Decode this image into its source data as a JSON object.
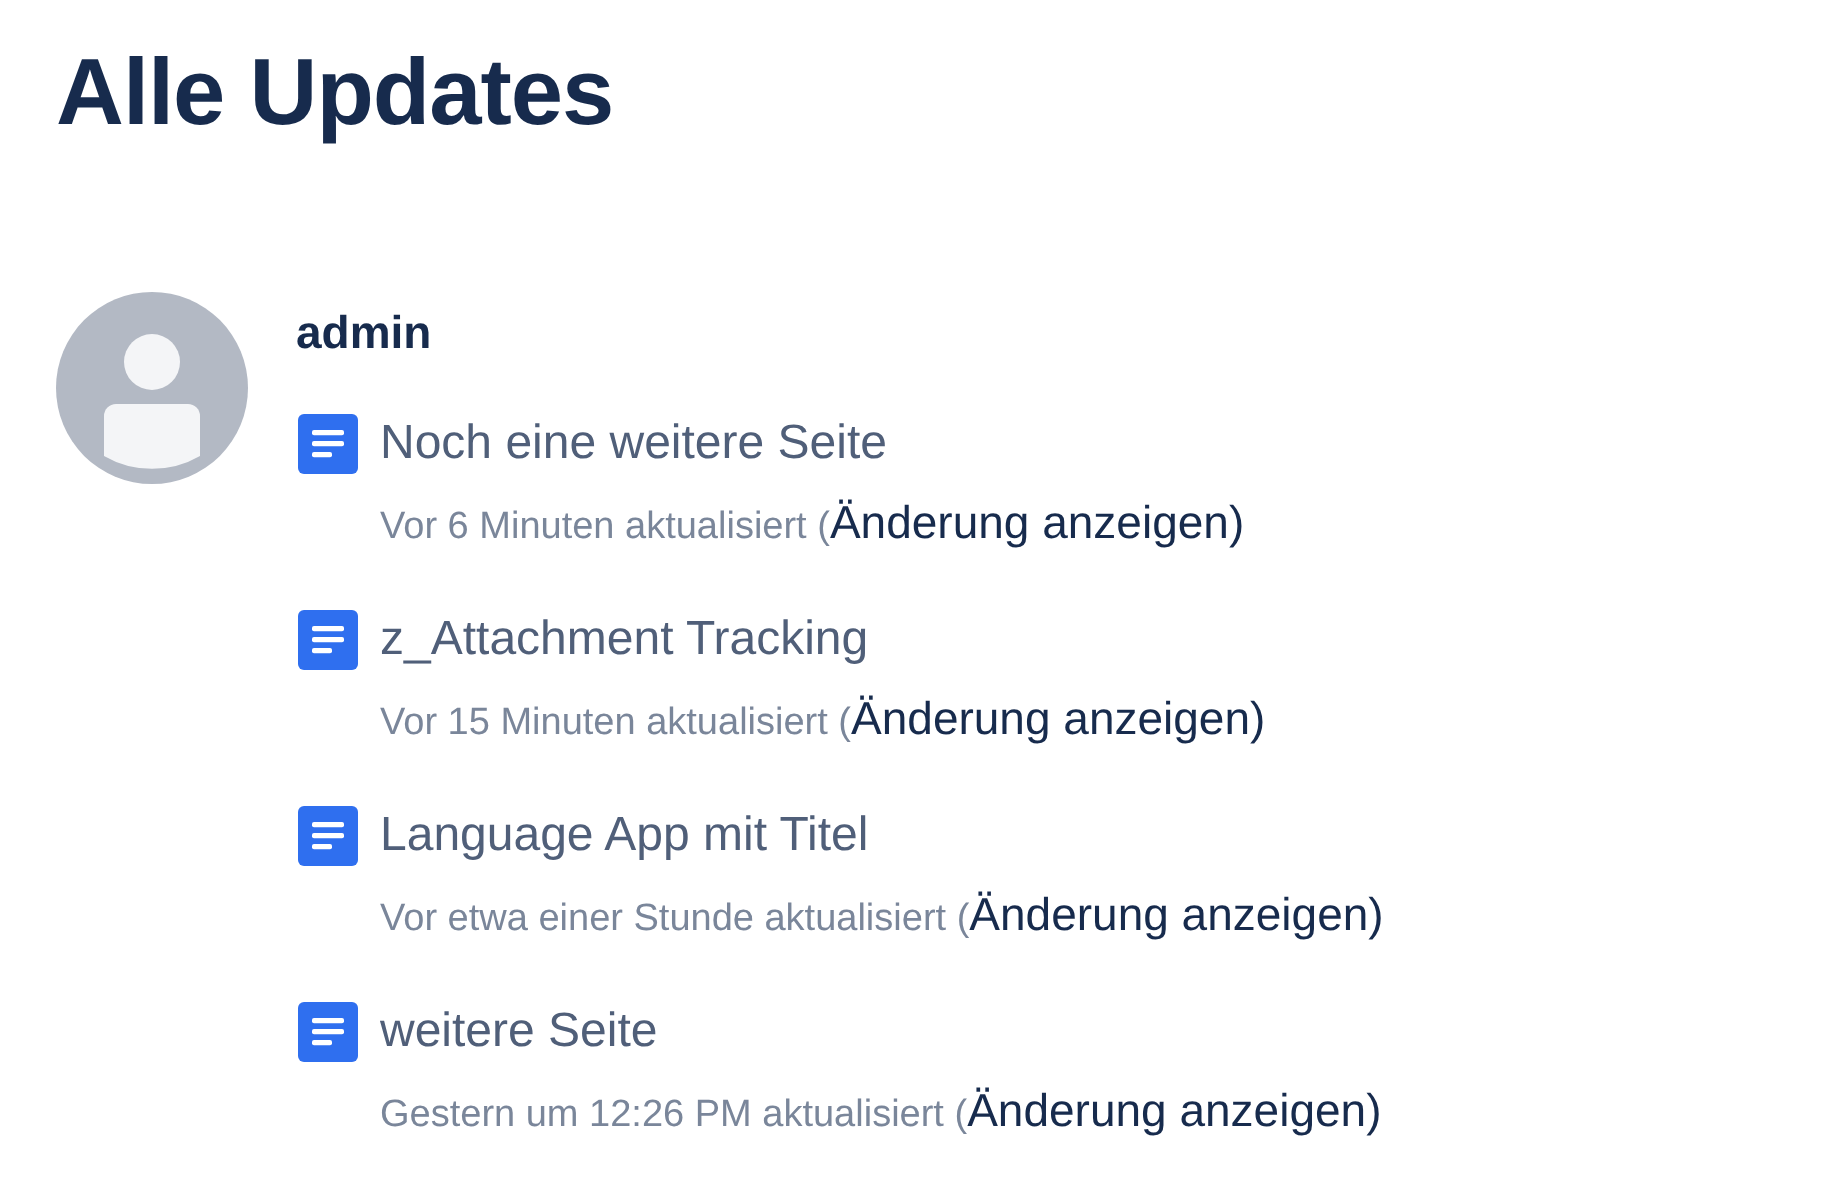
{
  "title": "Alle Updates",
  "user": {
    "name": "admin"
  },
  "updates": [
    {
      "page": "Noch eine weitere Seite",
      "meta": "Vor 6 Minuten aktualisiert (",
      "link": "Änderung anzeigen)"
    },
    {
      "page": "z_Attachment Tracking",
      "meta": "Vor 15 Minuten aktualisiert (",
      "link": "Änderung anzeigen)"
    },
    {
      "page": "Language App mit Titel",
      "meta": "Vor etwa einer Stunde aktualisiert (",
      "link": "Änderung anzeigen)"
    },
    {
      "page": "weitere Seite",
      "meta": "Gestern um 12:26 PM aktualisiert (",
      "link": "Änderung anzeigen)"
    }
  ]
}
